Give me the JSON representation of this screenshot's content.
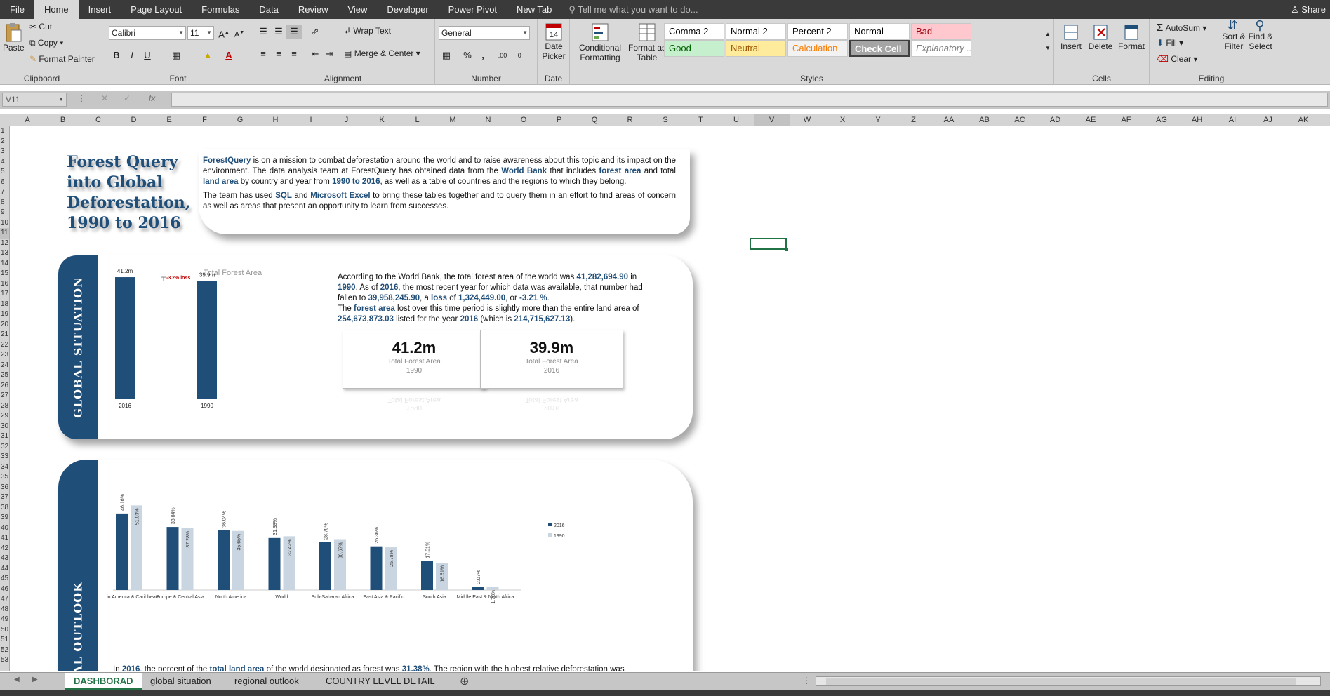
{
  "menu": {
    "file": "File",
    "tabs": [
      "Home",
      "Insert",
      "Page Layout",
      "Formulas",
      "Data",
      "Review",
      "View",
      "Developer",
      "Power Pivot",
      "New Tab"
    ],
    "tell_me": "Tell me what you want to do...",
    "share": "Share"
  },
  "ribbon": {
    "clipboard": {
      "paste": "Paste",
      "cut": "Cut",
      "copy": "Copy",
      "format_painter": "Format Painter",
      "label": "Clipboard"
    },
    "font": {
      "name": "Calibri",
      "size": "11",
      "label": "Font",
      "bold": "B",
      "italic": "I",
      "underline": "U"
    },
    "alignment": {
      "wrap": "Wrap Text",
      "merge": "Merge & Center",
      "label": "Alignment"
    },
    "number": {
      "format": "General",
      "percent": "%",
      "comma": ",",
      "label": "Number"
    },
    "date": {
      "picker": "Date Picker",
      "label": "Date",
      "icon_num": "14"
    },
    "styles": {
      "conditional": "Conditional Formatting",
      "format_table": "Format as Table",
      "label": "Styles",
      "cells": [
        {
          "name": "Comma 2",
          "bg": "#ffffff",
          "color": "#000000"
        },
        {
          "name": "Normal 2",
          "bg": "#ffffff",
          "color": "#000000"
        },
        {
          "name": "Percent 2",
          "bg": "#ffffff",
          "color": "#000000"
        },
        {
          "name": "Normal",
          "bg": "#ffffff",
          "color": "#000000"
        },
        {
          "name": "Bad",
          "bg": "#ffc7ce",
          "color": "#9c0006"
        },
        {
          "name": "Good",
          "bg": "#c6efce",
          "color": "#006100"
        },
        {
          "name": "Neutral",
          "bg": "#ffeb9c",
          "color": "#9c5700"
        },
        {
          "name": "Calculation",
          "bg": "#f2f2f2",
          "color": "#fa7d00"
        },
        {
          "name": "Check Cell",
          "bg": "#a5a5a5",
          "color": "#ffffff"
        },
        {
          "name": "Explanatory ...",
          "bg": "#ffffff",
          "color": "#7f7f7f"
        }
      ]
    },
    "cells": {
      "insert": "Insert",
      "delete": "Delete",
      "format": "Format",
      "label": "Cells"
    },
    "editing": {
      "autosum": "AutoSum",
      "fill": "Fill",
      "clear": "Clear",
      "sort": "Sort & Filter",
      "find": "Find & Select",
      "label": "Editing"
    }
  },
  "formula_bar": {
    "name_box": "V11",
    "fx": "fx"
  },
  "columns": [
    "A",
    "B",
    "C",
    "D",
    "E",
    "F",
    "G",
    "H",
    "I",
    "J",
    "K",
    "L",
    "M",
    "N",
    "O",
    "P",
    "Q",
    "R",
    "S",
    "T",
    "U",
    "V",
    "W",
    "X",
    "Y",
    "Z",
    "AA",
    "AB",
    "AC",
    "AD",
    "AE",
    "AF",
    "AG",
    "AH",
    "AI",
    "AJ",
    "AK"
  ],
  "selected_column": "V",
  "dashboard": {
    "title": "Forest Query into Global Deforestation, 1990 to 2016",
    "title_lines": [
      "Forest Query",
      "into Global",
      "Deforestation,",
      "1990 to 2016"
    ],
    "intro_p1": [
      {
        "t": "ForestQuery",
        "b": true
      },
      {
        "t": " is on a mission to combat deforestation around the world and to raise awareness about  this topic and its impact on the environment. The data analysis team at ForestQuery has obtained data from the "
      },
      {
        "t": "World Bank",
        "b": true
      },
      {
        "t": " that includes "
      },
      {
        "t": "forest area",
        "b": true
      },
      {
        "t": " and total "
      },
      {
        "t": "land area",
        "b": true
      },
      {
        "t": " by country and year from "
      },
      {
        "t": "1990 to 2016",
        "b": true
      },
      {
        "t": ", as well as a table of countries and the regions to which they belong."
      }
    ],
    "intro_p2": [
      {
        "t": "The team has used "
      },
      {
        "t": "SQL",
        "b": true
      },
      {
        "t": " and "
      },
      {
        "t": "Microsoft Excel",
        "b": true
      },
      {
        "t": " to bring these tables together and to query them in an  effort to find areas of concern as well as areas that present an opportunity to learn from successes."
      }
    ],
    "global_label": "GLOBAL SITUATION",
    "global_p1": [
      {
        "t": "According to the World Bank, the total forest area of the world was "
      },
      {
        "t": "41,282,694.90",
        "b": true
      },
      {
        "t": " in "
      },
      {
        "t": "1990",
        "b": true
      },
      {
        "t": ". As of "
      },
      {
        "t": "2016",
        "b": true
      },
      {
        "t": ", the most recent year for which data was available, that number had fallen to "
      },
      {
        "t": "39,958,245.90",
        "b": true
      },
      {
        "t": ", a "
      },
      {
        "t": "loss",
        "b": true
      },
      {
        "t": " of "
      },
      {
        "t": "1,324,449.00",
        "b": true
      },
      {
        "t": ", or "
      },
      {
        "t": "-3.21 %",
        "b": true
      },
      {
        "t": "."
      }
    ],
    "global_p2": [
      {
        "t": "The "
      },
      {
        "t": "forest area",
        "b": true
      },
      {
        "t": " lost over this time period is slightly more than the entire land area of "
      },
      {
        "t": "254,673,873.03",
        "b": true
      },
      {
        "t": " listed for the year "
      },
      {
        "t": "2016",
        "b": true
      },
      {
        "t": " (which is "
      },
      {
        "t": "214,715,627.13",
        "b": true
      },
      {
        "t": ")."
      }
    ],
    "kpis": [
      {
        "value": "41.2m",
        "label": "Total Forest Area",
        "year": "1990"
      },
      {
        "value": "39.9m",
        "label": "Total Forest Area",
        "year": "2016"
      }
    ],
    "regional_label": "AL OUTLOOK",
    "regional_text": [
      {
        "t": "In "
      },
      {
        "t": "2016",
        "b": true
      },
      {
        "t": ", the percent of the "
      },
      {
        "t": "total land area",
        "b": true
      },
      {
        "t": " of the world designated as forest was "
      },
      {
        "t": "31.38%",
        "b": true
      },
      {
        "t": ". The region with the highest relative deforestation was"
      }
    ]
  },
  "chart_data": [
    {
      "type": "bar",
      "title": "Total Forest Area",
      "categories": [
        "2016",
        "1990"
      ],
      "values": [
        41.2,
        39.9
      ],
      "value_labels": [
        "41.2m",
        "39.9m"
      ],
      "annotation": "-3.2% loss",
      "ylim": [
        0,
        45
      ],
      "color": "#1f4e79"
    },
    {
      "type": "bar",
      "categories": [
        "Latin America & Caribbean",
        "Europe & Central Asia",
        "North America",
        "World",
        "Sub-Saharan Africa",
        "East Asia & Pacific",
        "South Asia",
        "Middle East & North Africa"
      ],
      "series": [
        {
          "name": "2016",
          "values": [
            46.16,
            38.04,
            36.04,
            31.38,
            28.79,
            26.36,
            17.51,
            2.07
          ],
          "labels": [
            "46.16%",
            "38.04%",
            "36.04%",
            "31.38%",
            "28.79%",
            "26.36%",
            "17.51%",
            "2.07%"
          ],
          "color": "#1f4e79"
        },
        {
          "name": "1990",
          "values": [
            51.03,
            37.28,
            35.65,
            32.42,
            30.67,
            25.78,
            16.51,
            1.78
          ],
          "labels": [
            "51.03%",
            "37.28%",
            "35.65%",
            "32.42%",
            "30.67%",
            "25.78%",
            "16.51%",
            "1.78%"
          ],
          "color": "#c9d5e1"
        }
      ],
      "ylim": [
        0,
        55
      ],
      "legend": "right"
    }
  ],
  "sheet_tabs": [
    "DASHBORAD",
    "global situation",
    "regional outlook",
    "COUNTRY LEVEL DETAIL"
  ],
  "active_tab": "DASHBORAD"
}
